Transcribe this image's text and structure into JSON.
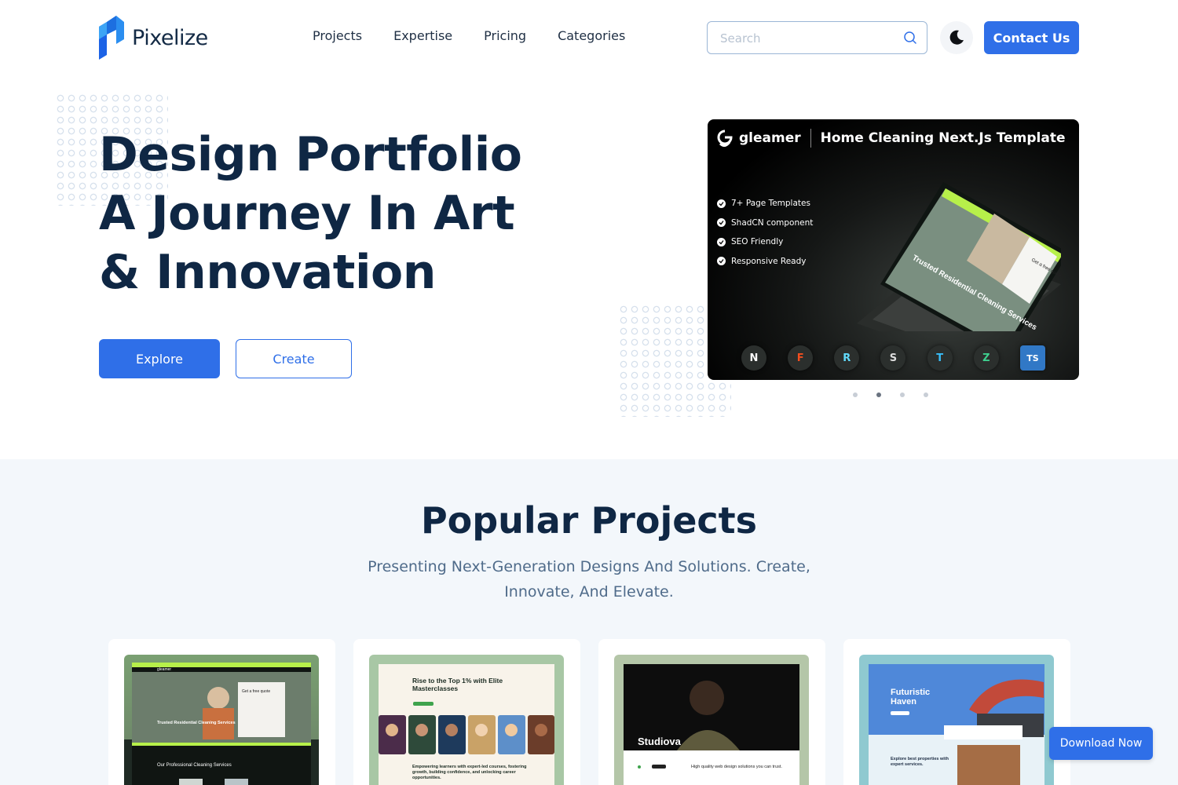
{
  "header": {
    "logo_text": "Pixelize",
    "nav": [
      "Projects",
      "Expertise",
      "Pricing",
      "Categories"
    ],
    "search_placeholder": "Search",
    "contact_label": "Contact Us"
  },
  "hero": {
    "title_lines": [
      "Design Portfolio",
      "A Journey In Art",
      "& Innovation"
    ],
    "explore_label": "Explore",
    "create_label": "Create"
  },
  "slide": {
    "brand": "gleamer",
    "heading": "Home Cleaning Next.Js Template",
    "features": [
      "7+ Page Templates",
      "ShadCN component",
      "SEO Friendly",
      "Responsive Ready"
    ],
    "laptop_text": "Trusted Residential Cleaning Services",
    "laptop_quote": "Get a free quote",
    "tech": [
      "N",
      "F",
      "R",
      "S",
      "T",
      "Z",
      "TS"
    ],
    "dots": 4,
    "active_dot": 1
  },
  "popular": {
    "title": "Popular Projects",
    "subtitle": "Presenting Next-Generation Designs And Solutions. Create, Innovate, And Elevate.",
    "cards": [
      {
        "caption": "Trusted Residential Cleaning Services",
        "sub": "Our Professional Cleaning Services",
        "quote": "Get a free quote",
        "brand": "gleamer",
        "colors": [
          "#7aa072",
          "#1f2a24"
        ]
      },
      {
        "caption": "Rise to the Top 1% with Elite Masterclasses",
        "sub": "Empowering learners with expert-led courses, fostering growth, building confidence, and unlocking career opportunities.",
        "colors": [
          "#a8c7a5",
          "#f8f3ea"
        ]
      },
      {
        "caption": "Studiova",
        "sub": "High quality web design solutions you can trust.",
        "colors": [
          "#b4c6a8",
          "#0d0d0d"
        ]
      },
      {
        "caption": "Futuristic Haven",
        "sub": "Explore best properties with expert services.",
        "colors": [
          "#8fc9d0",
          "#e8f2f7"
        ]
      }
    ]
  },
  "download_label": "Download Now"
}
